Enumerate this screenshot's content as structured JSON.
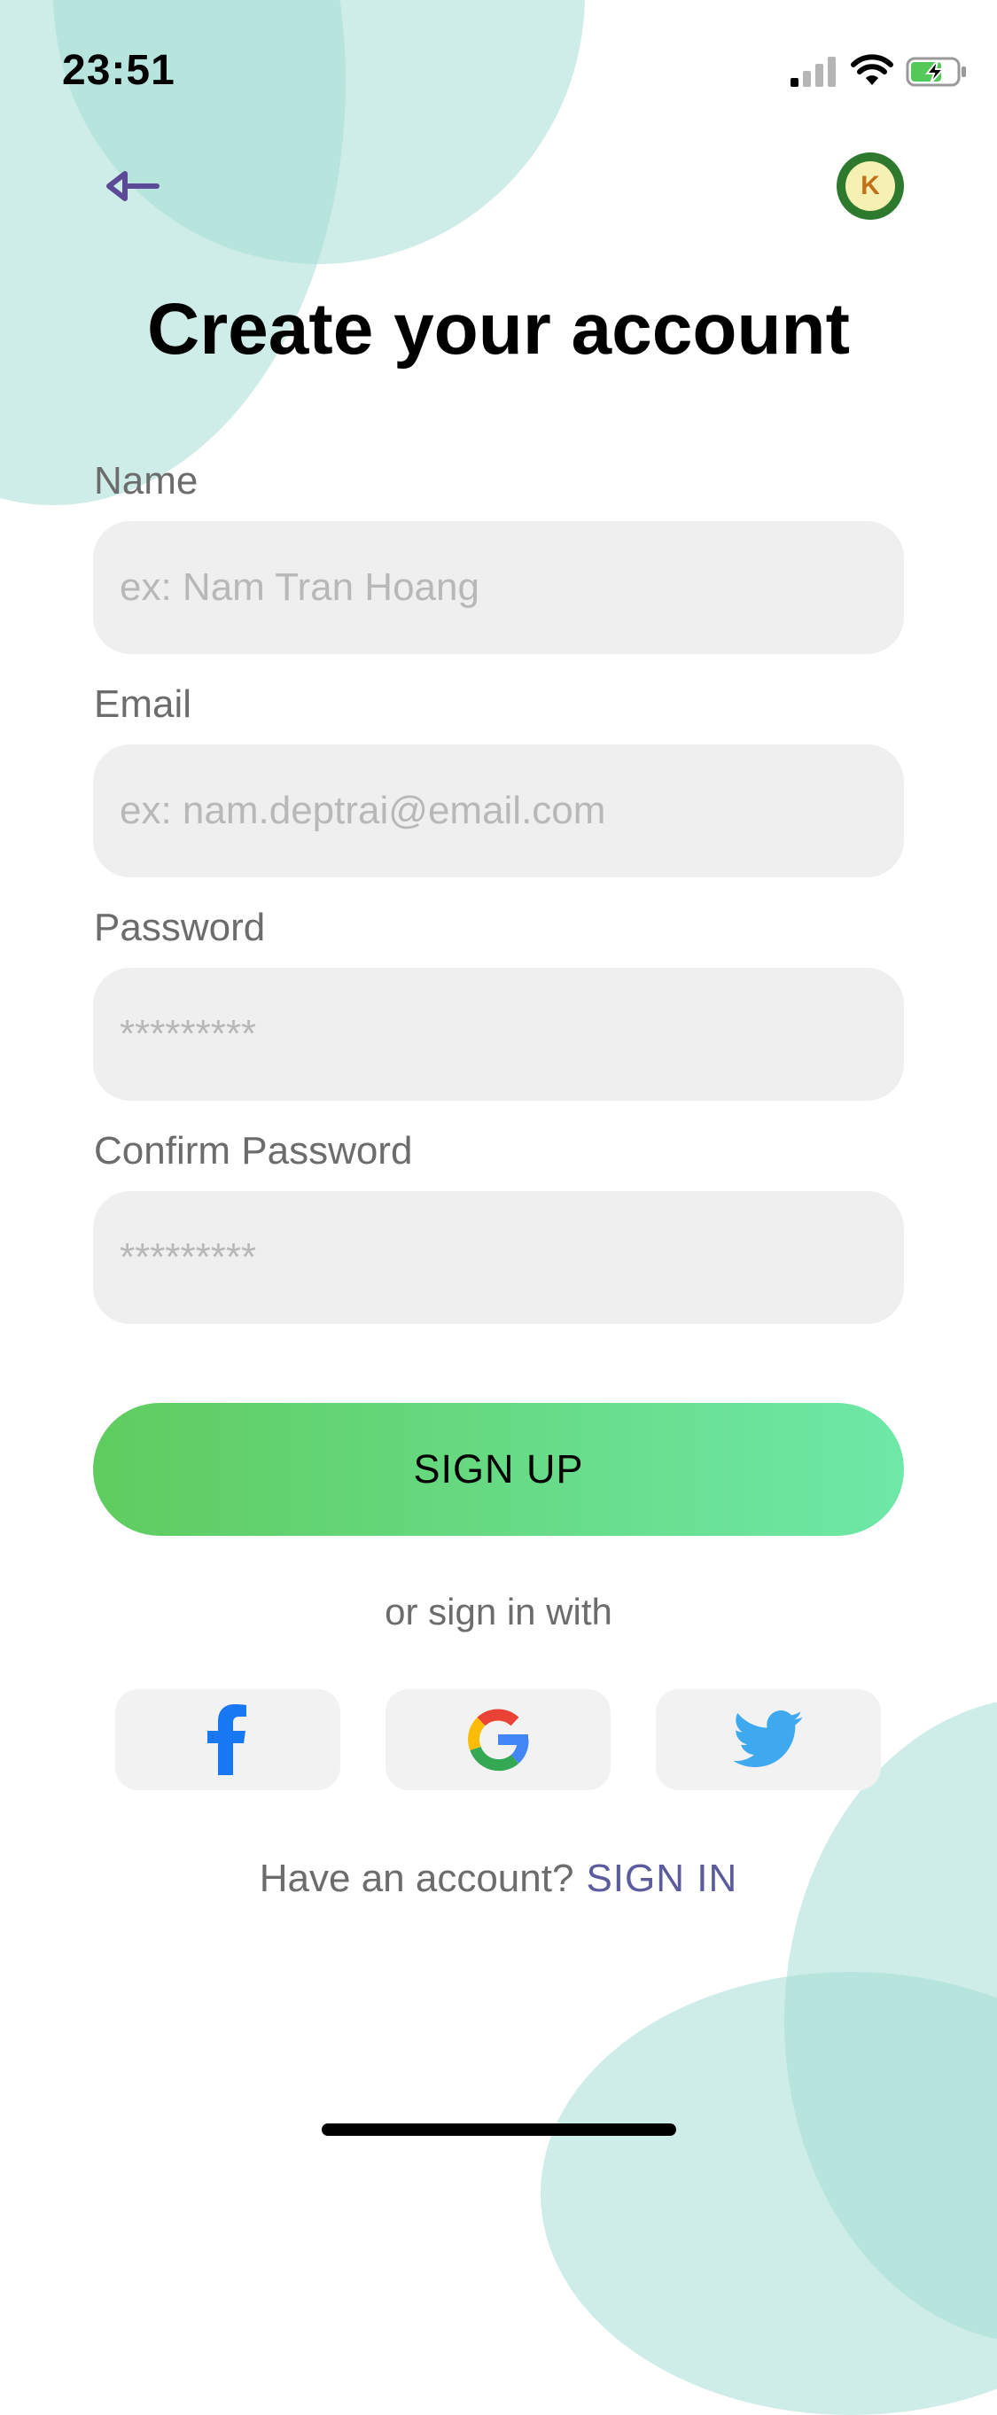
{
  "status_bar": {
    "time": "23:51"
  },
  "header": {
    "back_icon": "back-arrow-icon",
    "avatar_icon": "app-logo-icon"
  },
  "page": {
    "title": "Create your account"
  },
  "form": {
    "fields": [
      {
        "label": "Name",
        "placeholder": "ex: Nam Tran Hoang",
        "value": ""
      },
      {
        "label": "Email",
        "placeholder": "ex: nam.deptrai@email.com",
        "value": ""
      },
      {
        "label": "Password",
        "placeholder": "*********",
        "value": ""
      },
      {
        "label": "Confirm Password",
        "placeholder": "*********",
        "value": ""
      }
    ],
    "submit_label": "SIGN UP"
  },
  "social": {
    "divider_text": "or sign in with",
    "providers": [
      {
        "icon": "facebook-icon",
        "color": "#1877f2"
      },
      {
        "icon": "google-icon",
        "color": "#4285f4"
      },
      {
        "icon": "twitter-icon",
        "color": "#1da1f2"
      }
    ]
  },
  "footer": {
    "question": "Have an account?",
    "link_label": "SIGN IN"
  },
  "colors": {
    "accent_gradient_start": "#5fcc5f",
    "accent_gradient_end": "#6ee8a8",
    "link": "#5b5b9e",
    "bubble": "#9fdcd1"
  }
}
